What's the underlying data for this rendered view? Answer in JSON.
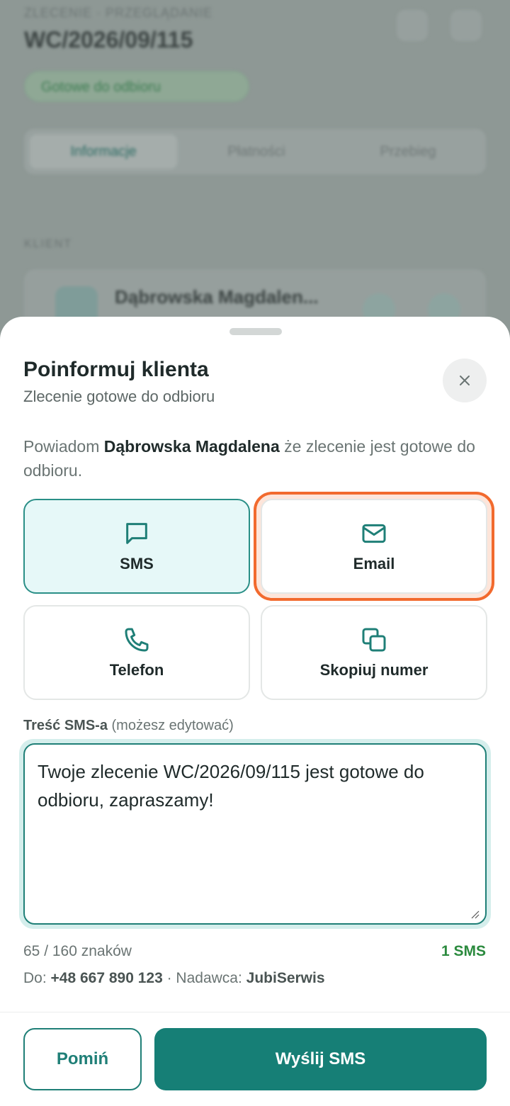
{
  "background": {
    "crumb": "ZLECENIE · PRZEGLĄDANIE",
    "order_number": "WC/2026/09/115",
    "status": "Gotowe do odbioru",
    "tabs": [
      "Informacje",
      "Płatności",
      "Przebieg"
    ],
    "section_label": "KLIENT",
    "client_name": "Dąbrowska Magdalen..."
  },
  "sheet": {
    "title": "Poinformuj klienta",
    "subtitle": "Zlecenie gotowe do odbioru",
    "intro_prefix": "Powiadom ",
    "intro_name": "Dąbrowska Magdalena",
    "intro_suffix": " że zlecenie jest gotowe do odbioru.",
    "options": [
      {
        "label": "SMS",
        "icon": "message-square-icon",
        "selected": true
      },
      {
        "label": "Email",
        "icon": "mail-icon",
        "selected": false
      },
      {
        "label": "Telefon",
        "icon": "phone-icon",
        "selected": false
      },
      {
        "label": "Skopiuj numer",
        "icon": "copy-icon",
        "selected": false
      }
    ],
    "field_label_bold": "Treść SMS-a",
    "field_label_hint": " (możesz edytować)",
    "message": "Twoje zlecenie WC/2026/09/115 jest gotowe do odbioru, zapraszamy!",
    "char_counter": "65 / 160 znaków",
    "sms_count": "1 SMS",
    "to_label": "Do: ",
    "to_number": "+48 667 890 123",
    "sender_label": " · Nadawca: ",
    "sender_name": "JubiSerwis",
    "skip_label": "Pomiń",
    "send_label": "Wyślij SMS"
  },
  "colors": {
    "accent": "#167f76",
    "selected_bg": "#e6f8f8",
    "highlight": "#f26a2e",
    "sms_count": "#2b8a3e"
  }
}
